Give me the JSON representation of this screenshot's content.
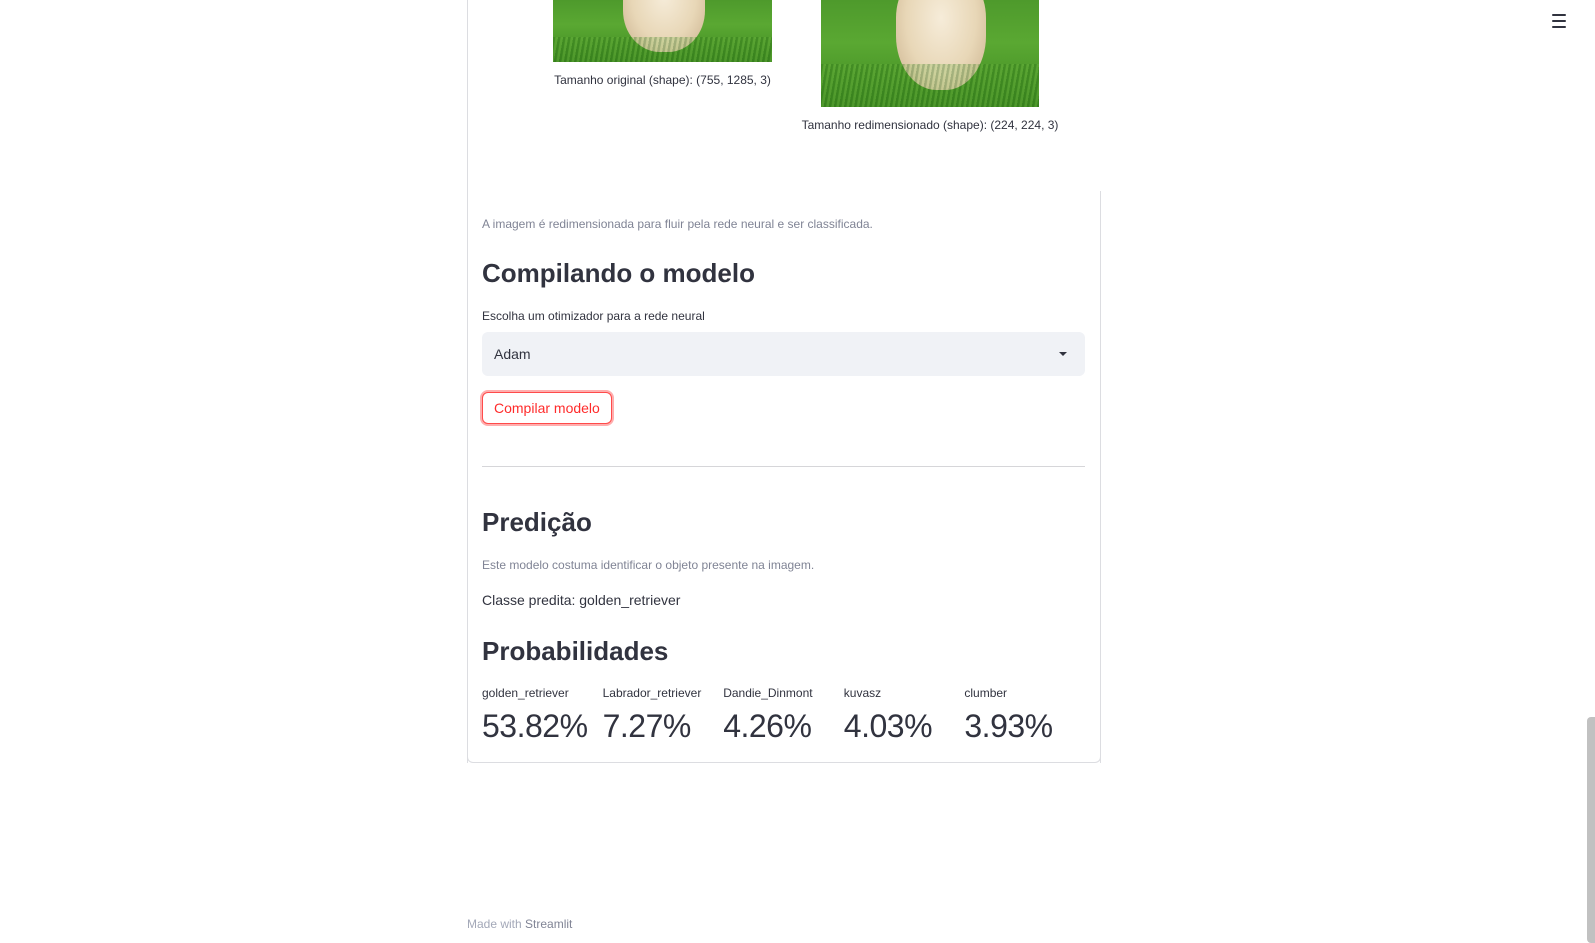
{
  "images": {
    "original_caption": "Tamanho original (shape): (755, 1285, 3)",
    "resized_caption": "Tamanho redimensionado (shape): (224, 224, 3)"
  },
  "resize_note": "A imagem é redimensionada para fluir pela rede neural e ser classificada.",
  "compile": {
    "heading": "Compilando o modelo",
    "select_label": "Escolha um otimizador para a rede neural",
    "select_value": "Adam",
    "button_label": "Compilar modelo"
  },
  "prediction": {
    "heading": "Predição",
    "note": "Este modelo costuma identificar o objeto presente na imagem.",
    "predicted_class": "Classe predita: golden_retriever"
  },
  "probabilities": {
    "heading": "Probabilidades",
    "items": [
      {
        "label": "golden_retriever",
        "value": "53.82%"
      },
      {
        "label": "Labrador_retriever",
        "value": "7.27%"
      },
      {
        "label": "Dandie_Dinmont",
        "value": "4.26%"
      },
      {
        "label": "kuvasz",
        "value": "4.03%"
      },
      {
        "label": "clumber",
        "value": "3.93%"
      }
    ]
  },
  "footer": {
    "prefix": "Made with",
    "brand": "Streamlit"
  },
  "colors": {
    "accent": "#ff4b4b",
    "text": "#31333f",
    "muted": "#808495",
    "select_bg": "#f0f2f6"
  },
  "icons": {
    "menu": "hamburger-menu-icon",
    "caret": "caret-down-icon"
  }
}
